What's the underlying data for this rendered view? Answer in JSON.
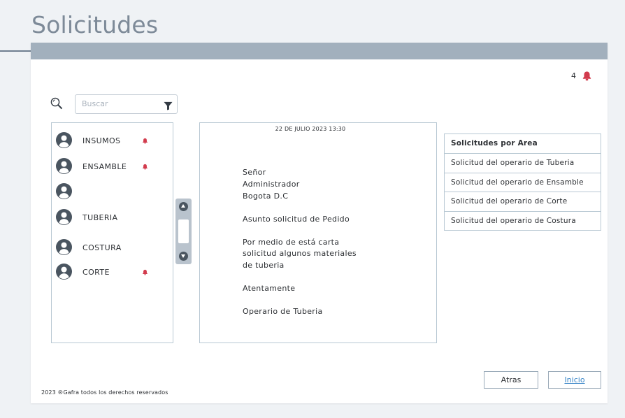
{
  "page_title": "Solicitudes",
  "notifications": {
    "count": "4",
    "icon": "bell-icon",
    "color": "#d23b4d"
  },
  "search": {
    "placeholder": "Buscar",
    "value": ""
  },
  "areas_list": [
    {
      "label": "INSUMOS",
      "alert": true
    },
    {
      "label": "ENSAMBLE",
      "alert": true
    },
    {
      "label": "",
      "alert": false
    },
    {
      "label": "TUBERIA",
      "alert": false
    },
    {
      "label": "COSTURA",
      "alert": false
    },
    {
      "label": "CORTE",
      "alert": true
    }
  ],
  "letter": {
    "date": "22 DE JULIO 2023  13:30",
    "lines": [
      "Señor",
      "Administrador",
      "Bogota D.C",
      "Asunto solicitud de Pedido",
      "Por medio de está carta",
      "solicitud algunos materiales",
      "de tuberia",
      "Atentamente",
      "Operario de Tuberia"
    ]
  },
  "requests_table": {
    "header": "Solicitudes por Area",
    "rows": [
      "Solicitud del operario de Tuberia",
      "Solicitud del operario de Ensamble",
      "Solicitud del operario de Corte",
      "Solicitud del operario de Costura"
    ]
  },
  "buttons": {
    "back": "Atras",
    "home": "Inicio"
  },
  "footer": "2023 ®Gafra todos los derechos reservados",
  "colors": {
    "header_bar": "#a2b0bd",
    "accent_link": "#3a86c8",
    "alert": "#d23b4d",
    "avatar": "#4a5560"
  }
}
